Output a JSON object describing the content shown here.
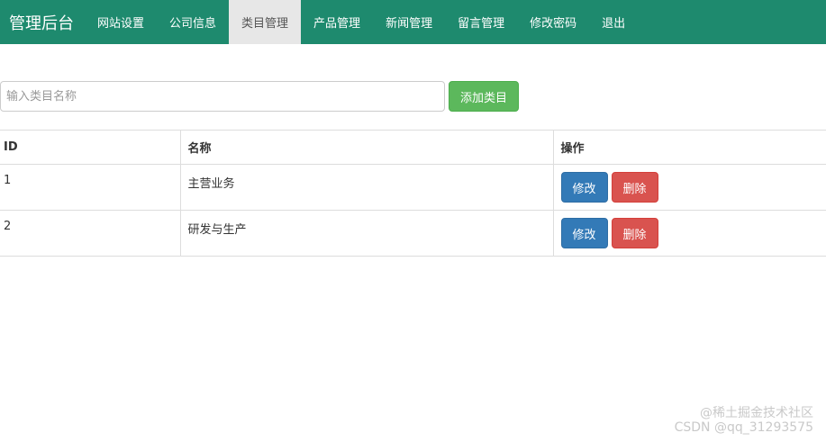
{
  "navbar": {
    "brand": "管理后台",
    "items": [
      {
        "label": "网站设置"
      },
      {
        "label": "公司信息"
      },
      {
        "label": "类目管理",
        "active": true
      },
      {
        "label": "产品管理"
      },
      {
        "label": "新闻管理"
      },
      {
        "label": "留言管理"
      },
      {
        "label": "修改密码"
      },
      {
        "label": "退出"
      }
    ],
    "color": "#1e8a6e"
  },
  "toolbar": {
    "search_placeholder": "输入类目名称",
    "add_label": "添加类目"
  },
  "table": {
    "headers": [
      "ID",
      "名称",
      "操作"
    ],
    "rows": [
      {
        "id": "1",
        "name": "主营业务",
        "edit": "修改",
        "delete": "删除"
      },
      {
        "id": "2",
        "name": "研发与生产",
        "edit": "修改",
        "delete": "删除"
      }
    ]
  },
  "watermark": {
    "line1": "@稀土掘金技术社区",
    "line2": "CSDN @qq_31293575"
  }
}
